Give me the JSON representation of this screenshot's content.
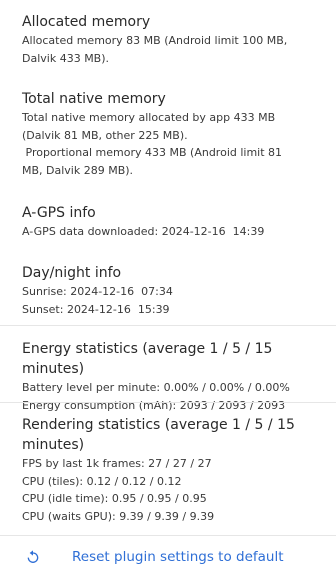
{
  "sections": [
    {
      "title": "Allocated memory",
      "lines": "Allocated memory 83 MB (Android limit 100 MB,\nDalvik 433 MB)."
    },
    {
      "title": "Total native memory",
      "lines": "Total native memory allocated by app 433 MB\n(Dalvik 81 MB, other 225 MB).\n Proportional memory 433 MB (Android limit 81\nMB, Dalvik 289 MB)."
    },
    {
      "title": "A-GPS info",
      "lines": "A-GPS data downloaded: 2024-12-16  14:39"
    },
    {
      "title": "Day/night info",
      "lines": "Sunrise: 2024-12-16  07:34\nSunset: 2024-12-16  15:39"
    },
    {
      "title": "Energy statistics (average 1 / 5 / 15 minutes)",
      "lines": "Battery level per minute: 0.00% / 0.00% / 0.00%\nEnergy consumption (mAh): 2093 / 2093 / 2093"
    },
    {
      "title": "Rendering statistics (average 1 / 5 / 15\nminutes)",
      "lines": "FPS by last 1k frames: 27 / 27 / 27\nCPU (tiles): 0.12 / 0.12 / 0.12\nCPU (idle time): 0.95 / 0.95 / 0.95\nCPU (waits GPU): 9.39 / 9.39 / 9.39"
    }
  ],
  "reset": {
    "label": "Reset plugin settings to default",
    "icon": "reset-icon",
    "color": "#2f6fd6"
  }
}
